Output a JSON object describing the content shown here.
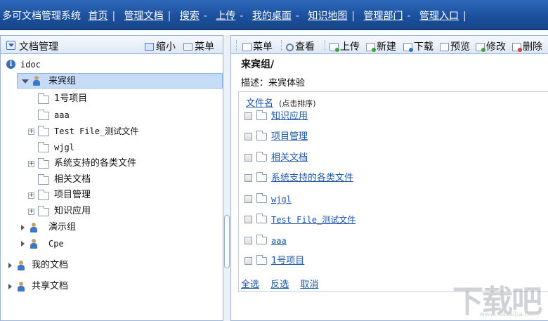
{
  "topnav": {
    "app_title": "多可文档管理系统",
    "items": [
      "首页",
      "管理文档",
      "搜索",
      "上传",
      "我的桌面",
      "知识地图",
      "管理部门",
      "管理入口"
    ]
  },
  "left_panel": {
    "title": "文档管理",
    "shrink_label": "缩小",
    "menu_label": "菜单",
    "tree": {
      "root": "idoc",
      "guest_group": "来宾组",
      "guest_children": [
        "1号项目",
        "aaa",
        "Test File_测试文件",
        "wjgl",
        "系统支持的各类文件",
        "相关文档",
        "项目管理",
        "知识应用"
      ],
      "demo_group": "演示组",
      "cpe_group": "Cpe",
      "my_docs": "我的文档",
      "shared_docs": "共享文档"
    }
  },
  "toolbar": {
    "menu": "菜单",
    "view": "查看",
    "upload": "上传",
    "new": "新建",
    "download": "下载",
    "preview": "预览",
    "edit": "修改",
    "delete": "删除"
  },
  "content": {
    "path": "来宾组/",
    "description": "描述：来宾体验",
    "column_header": "文件名",
    "sort_hint": "(点击排序)",
    "files": [
      "知识应用",
      "项目管理",
      "相关文档",
      "系统支持的各类文件",
      "wjgl",
      "Test File_测试文件",
      "aaa",
      "1号项目"
    ],
    "select_all": "全选",
    "invert": "反选",
    "cancel": "取消"
  },
  "watermark": {
    "text": "下载吧",
    "url": "www.xiazaiba.com"
  },
  "colors": {
    "topbar": "#1b4f9c",
    "link": "#1b56a8",
    "selected_row": "#c5dbf7",
    "panel_border": "#98b3d8"
  }
}
